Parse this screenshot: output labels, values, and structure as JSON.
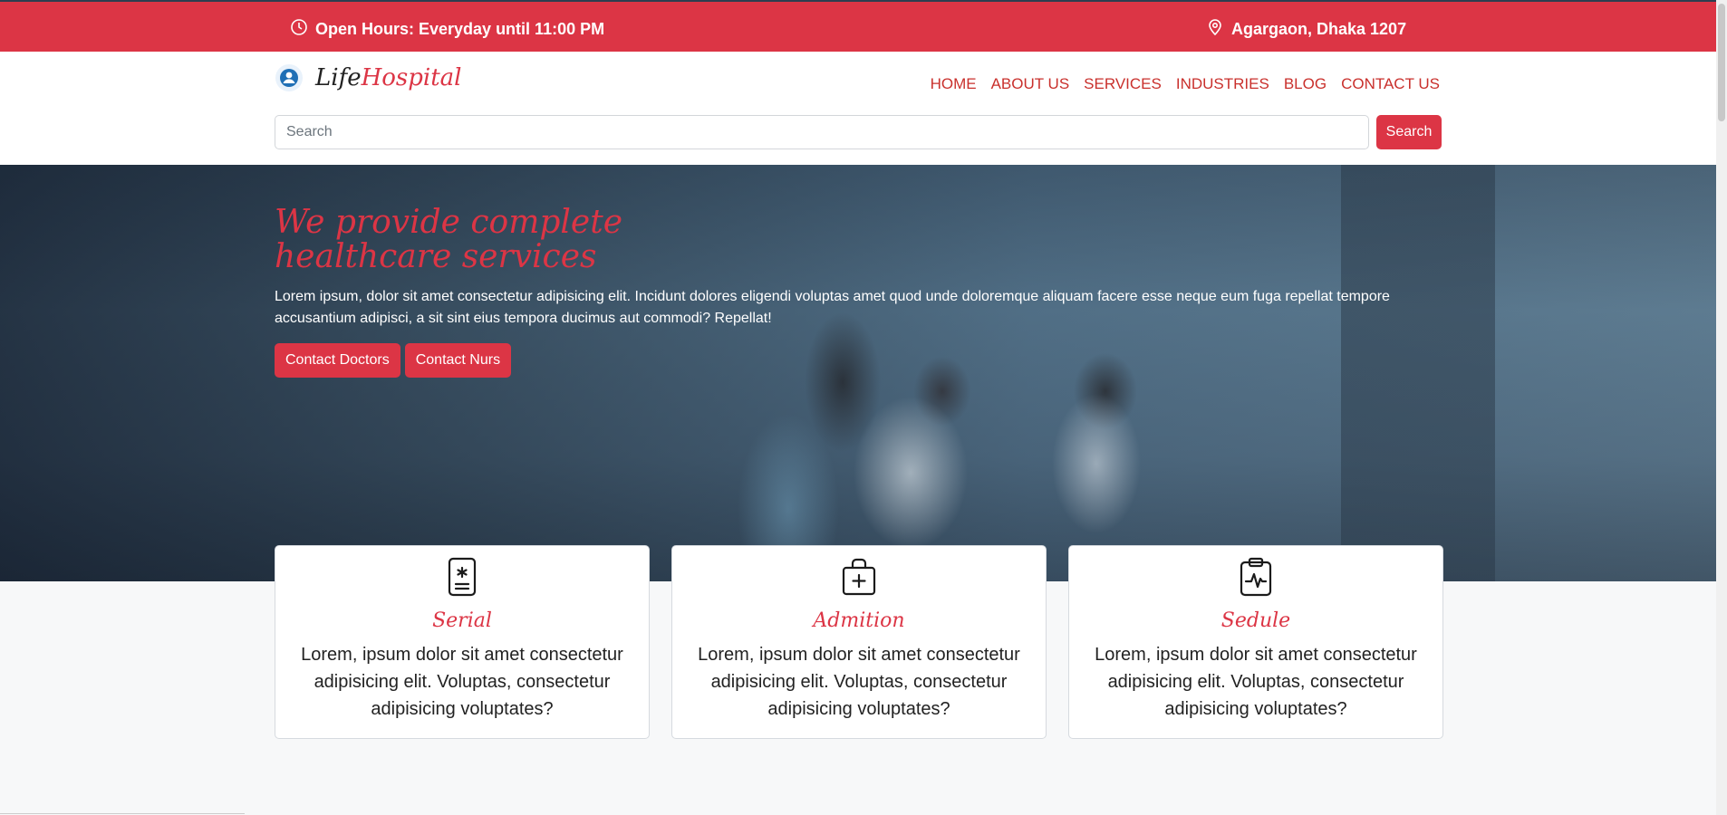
{
  "topbar": {
    "open_hours": "Open Hours: Everyday until 11:00 PM",
    "address": "Agargaon, Dhaka 1207",
    "clock_icon": "clock-icon",
    "location_icon": "map-pin-icon",
    "background_color": "#dc3545"
  },
  "brand": {
    "logo_icon": "hospital-user-icon",
    "name_prefix": "Life",
    "name_accent": "Hospital"
  },
  "nav": {
    "items": [
      "HOME",
      "ABOUT US",
      "SERVICES",
      "INDUSTRIES",
      "BLOG",
      "CONTACT US"
    ]
  },
  "search": {
    "placeholder": "Search",
    "value": "",
    "button_label": "Search"
  },
  "hero": {
    "title": "We provide complete healthcare services",
    "text": "Lorem ipsum, dolor sit amet consectetur adipisicing elit. Incidunt dolores eligendi voluptas amet quod unde doloremque aliquam facere esse neque eum fuga repellat tempore accusantium adipisci, a sit sint eius tempora ducimus aut commodi? Repellat!",
    "buttons": [
      "Contact Doctors",
      "Contact Nurs"
    ]
  },
  "cards": [
    {
      "icon": "id-badge-icon",
      "title": "Serial",
      "text": "Lorem, ipsum dolor sit amet consectetur adipisicing elit. Voluptas, consectetur adipisicing voluptates?"
    },
    {
      "icon": "medical-bag-icon",
      "title": "Admition",
      "text": "Lorem, ipsum dolor sit amet consectetur adipisicing elit. Voluptas, consectetur adipisicing voluptates?"
    },
    {
      "icon": "clipboard-pulse-icon",
      "title": "Sedule",
      "text": "Lorem, ipsum dolor sit amet consectetur adipisicing elit. Voluptas, consectetur adipisicing voluptates?"
    }
  ],
  "colors": {
    "accent": "#dc3545",
    "nav_text": "#c9302c"
  }
}
